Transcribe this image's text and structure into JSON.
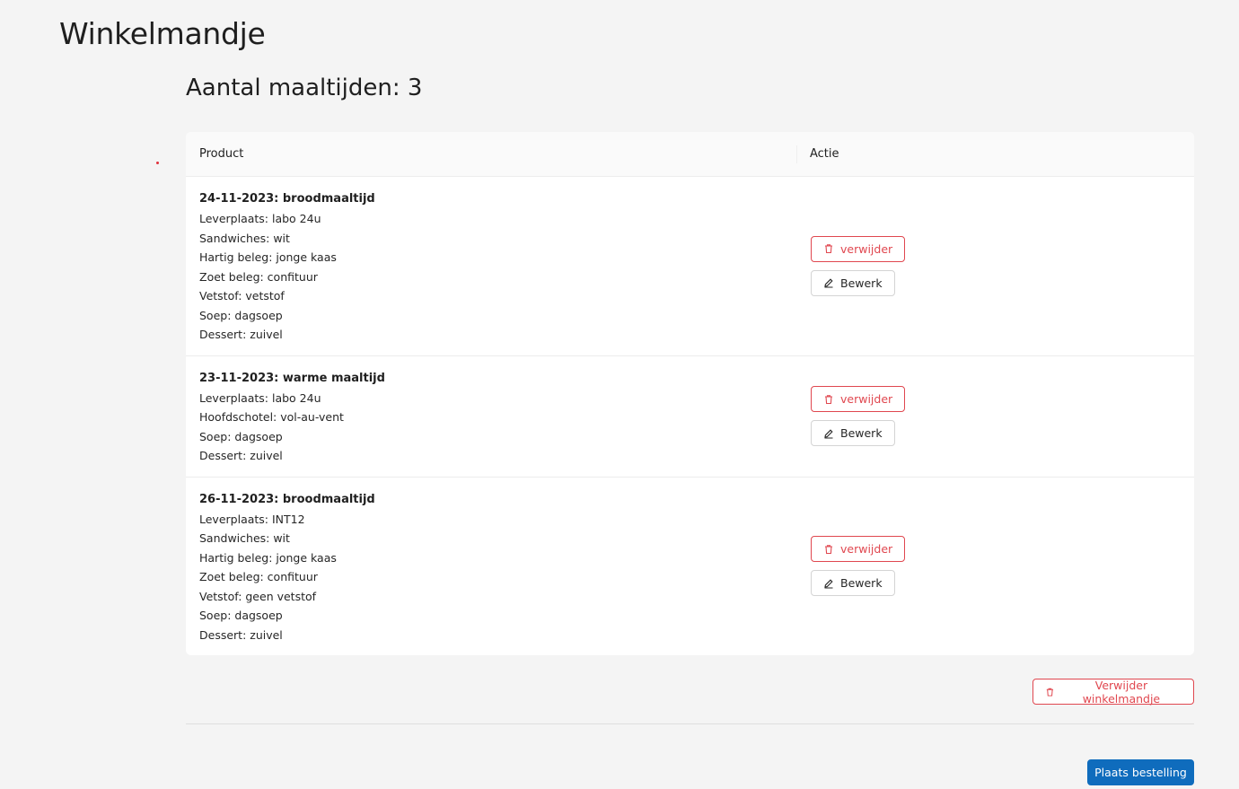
{
  "header": {
    "title": "Winkelmandje"
  },
  "summary": {
    "count_label": "Aantal maaltijden: 3"
  },
  "table": {
    "columns": {
      "product": "Product",
      "actie": "Actie"
    },
    "rows": [
      {
        "title": "24-11-2023: broodmaaltijd",
        "details": [
          "Leverplaats: labo 24u",
          "Sandwiches: wit",
          "Hartig beleg: jonge kaas",
          "Zoet beleg: confituur",
          "Vetstof: vetstof",
          "Soep: dagsoep",
          "Dessert: zuivel"
        ]
      },
      {
        "title": "23-11-2023: warme maaltijd",
        "details": [
          "Leverplaats: labo 24u",
          "Hoofdschotel: vol-au-vent",
          "Soep: dagsoep",
          "Dessert: zuivel"
        ]
      },
      {
        "title": "26-11-2023: broodmaaltijd",
        "details": [
          "Leverplaats: INT12",
          "Sandwiches: wit",
          "Hartig beleg: jonge kaas",
          "Zoet beleg: confituur",
          "Vetstof: geen vetstof",
          "Soep: dagsoep",
          "Dessert: zuivel"
        ]
      }
    ],
    "actions": {
      "delete_label": "verwijder",
      "edit_label": "Bewerk"
    }
  },
  "footer": {
    "clear_cart_label": "Verwijder winkelmandje",
    "place_order_label": "Plaats bestelling"
  },
  "icons": {
    "delete": "trash-icon",
    "edit": "pencil-icon"
  },
  "colors": {
    "danger": "#e0474f",
    "primary": "#0f6cbd",
    "background": "#f4f4f4"
  }
}
